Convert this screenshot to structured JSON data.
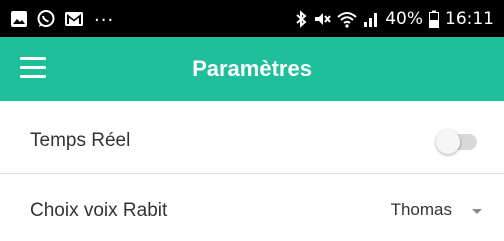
{
  "status_bar": {
    "overflow_indicator": "...",
    "battery_percent": "40%",
    "time": "16:11",
    "left_icons": [
      "image-icon",
      "whatsapp-icon",
      "gmail-icon"
    ],
    "right_icons": [
      "bluetooth-icon",
      "mute-icon",
      "wifi-icon",
      "signal-icon",
      "battery-icon"
    ]
  },
  "app_bar": {
    "title": "Paramètres",
    "background_color": "#1fbf9b",
    "menu_icon": "hamburger-menu-icon"
  },
  "settings": {
    "realtime": {
      "label": "Temps Réel",
      "enabled": false
    },
    "voice": {
      "label": "Choix voix Rabit",
      "selected": "Thomas"
    }
  }
}
